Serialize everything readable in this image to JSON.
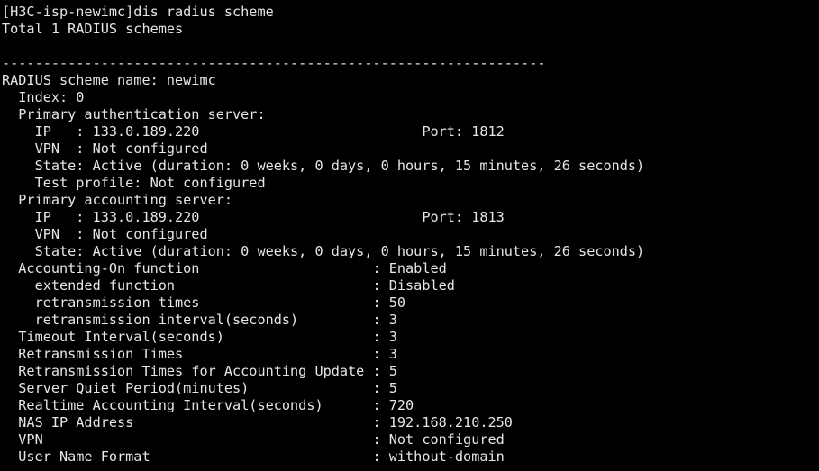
{
  "terminal": {
    "colors": {
      "background": "#000000",
      "text": "#e6e6e6"
    },
    "lines": [
      "[H3C-isp-newimc]dis radius scheme",
      "Total 1 RADIUS schemes",
      "",
      "------------------------------------------------------------------",
      "RADIUS scheme name: newimc",
      "  Index: 0",
      "  Primary authentication server:",
      "    IP   : 133.0.189.220                           Port: 1812",
      "    VPN  : Not configured",
      "    State: Active (duration: 0 weeks, 0 days, 0 hours, 15 minutes, 26 seconds)",
      "    Test profile: Not configured",
      "  Primary accounting server:",
      "    IP   : 133.0.189.220                           Port: 1813",
      "    VPN  : Not configured",
      "    State: Active (duration: 0 weeks, 0 days, 0 hours, 15 minutes, 26 seconds)",
      "  Accounting-On function                     : Enabled",
      "    extended function                        : Disabled",
      "    retransmission times                     : 50",
      "    retransmission interval(seconds)         : 3",
      "  Timeout Interval(seconds)                  : 3",
      "  Retransmission Times                       : 3",
      "  Retransmission Times for Accounting Update : 5",
      "  Server Quiet Period(minutes)               : 5",
      "  Realtime Accounting Interval(seconds)      : 720",
      "  NAS IP Address                             : 192.168.210.250",
      "  VPN                                        : Not configured",
      "  User Name Format                           : without-domain"
    ]
  }
}
